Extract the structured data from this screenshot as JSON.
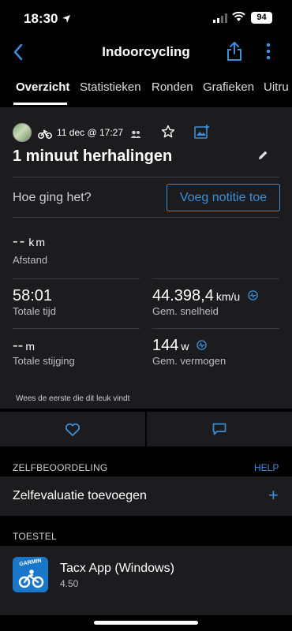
{
  "status": {
    "time": "18:30",
    "battery": "94"
  },
  "nav": {
    "title": "Indoorcycling"
  },
  "tabs": [
    "Overzicht",
    "Statistieken",
    "Ronden",
    "Grafieken",
    "Uitru"
  ],
  "activity": {
    "date": "11 dec @ 17:27",
    "title": "1 minuut herhalingen",
    "feel_prompt": "Hoe ging het?",
    "note_button": "Voeg notitie toe"
  },
  "stats": [
    {
      "value": "--",
      "unit": "km",
      "label": "Afstand"
    },
    {
      "value": "58:01",
      "unit": "",
      "label": "Totale tijd"
    },
    {
      "value": "44.398,4",
      "unit": "km/u",
      "label": "Gem. snelheid"
    },
    {
      "value": "--",
      "unit": "m",
      "label": "Totale stijging"
    },
    {
      "value": "144",
      "unit": "w",
      "label": "Gem. vermogen"
    }
  ],
  "likes_text": "Wees de eerste die dit leuk vindt",
  "self_eval": {
    "section": "ZELFBEOORDELING",
    "help": "HELP",
    "add_label": "Zelfevaluatie toevoegen",
    "plus": "+"
  },
  "device": {
    "section": "TOESTEL",
    "brand": "GARMIN",
    "name": "Tacx App (Windows)",
    "version": "4.50"
  },
  "colors": {
    "accent": "#3b8fd9",
    "card": "#1c1c1e",
    "background": "#000000"
  },
  "icons": [
    "location-arrow-icon",
    "signal-icon",
    "wifi-icon",
    "back-chevron-icon",
    "share-icon",
    "more-vertical-icon",
    "bike-icon",
    "people-icon",
    "star-icon",
    "add-photo-icon",
    "pencil-icon",
    "pulse-icon",
    "heart-icon",
    "comment-icon",
    "plus-icon"
  ]
}
